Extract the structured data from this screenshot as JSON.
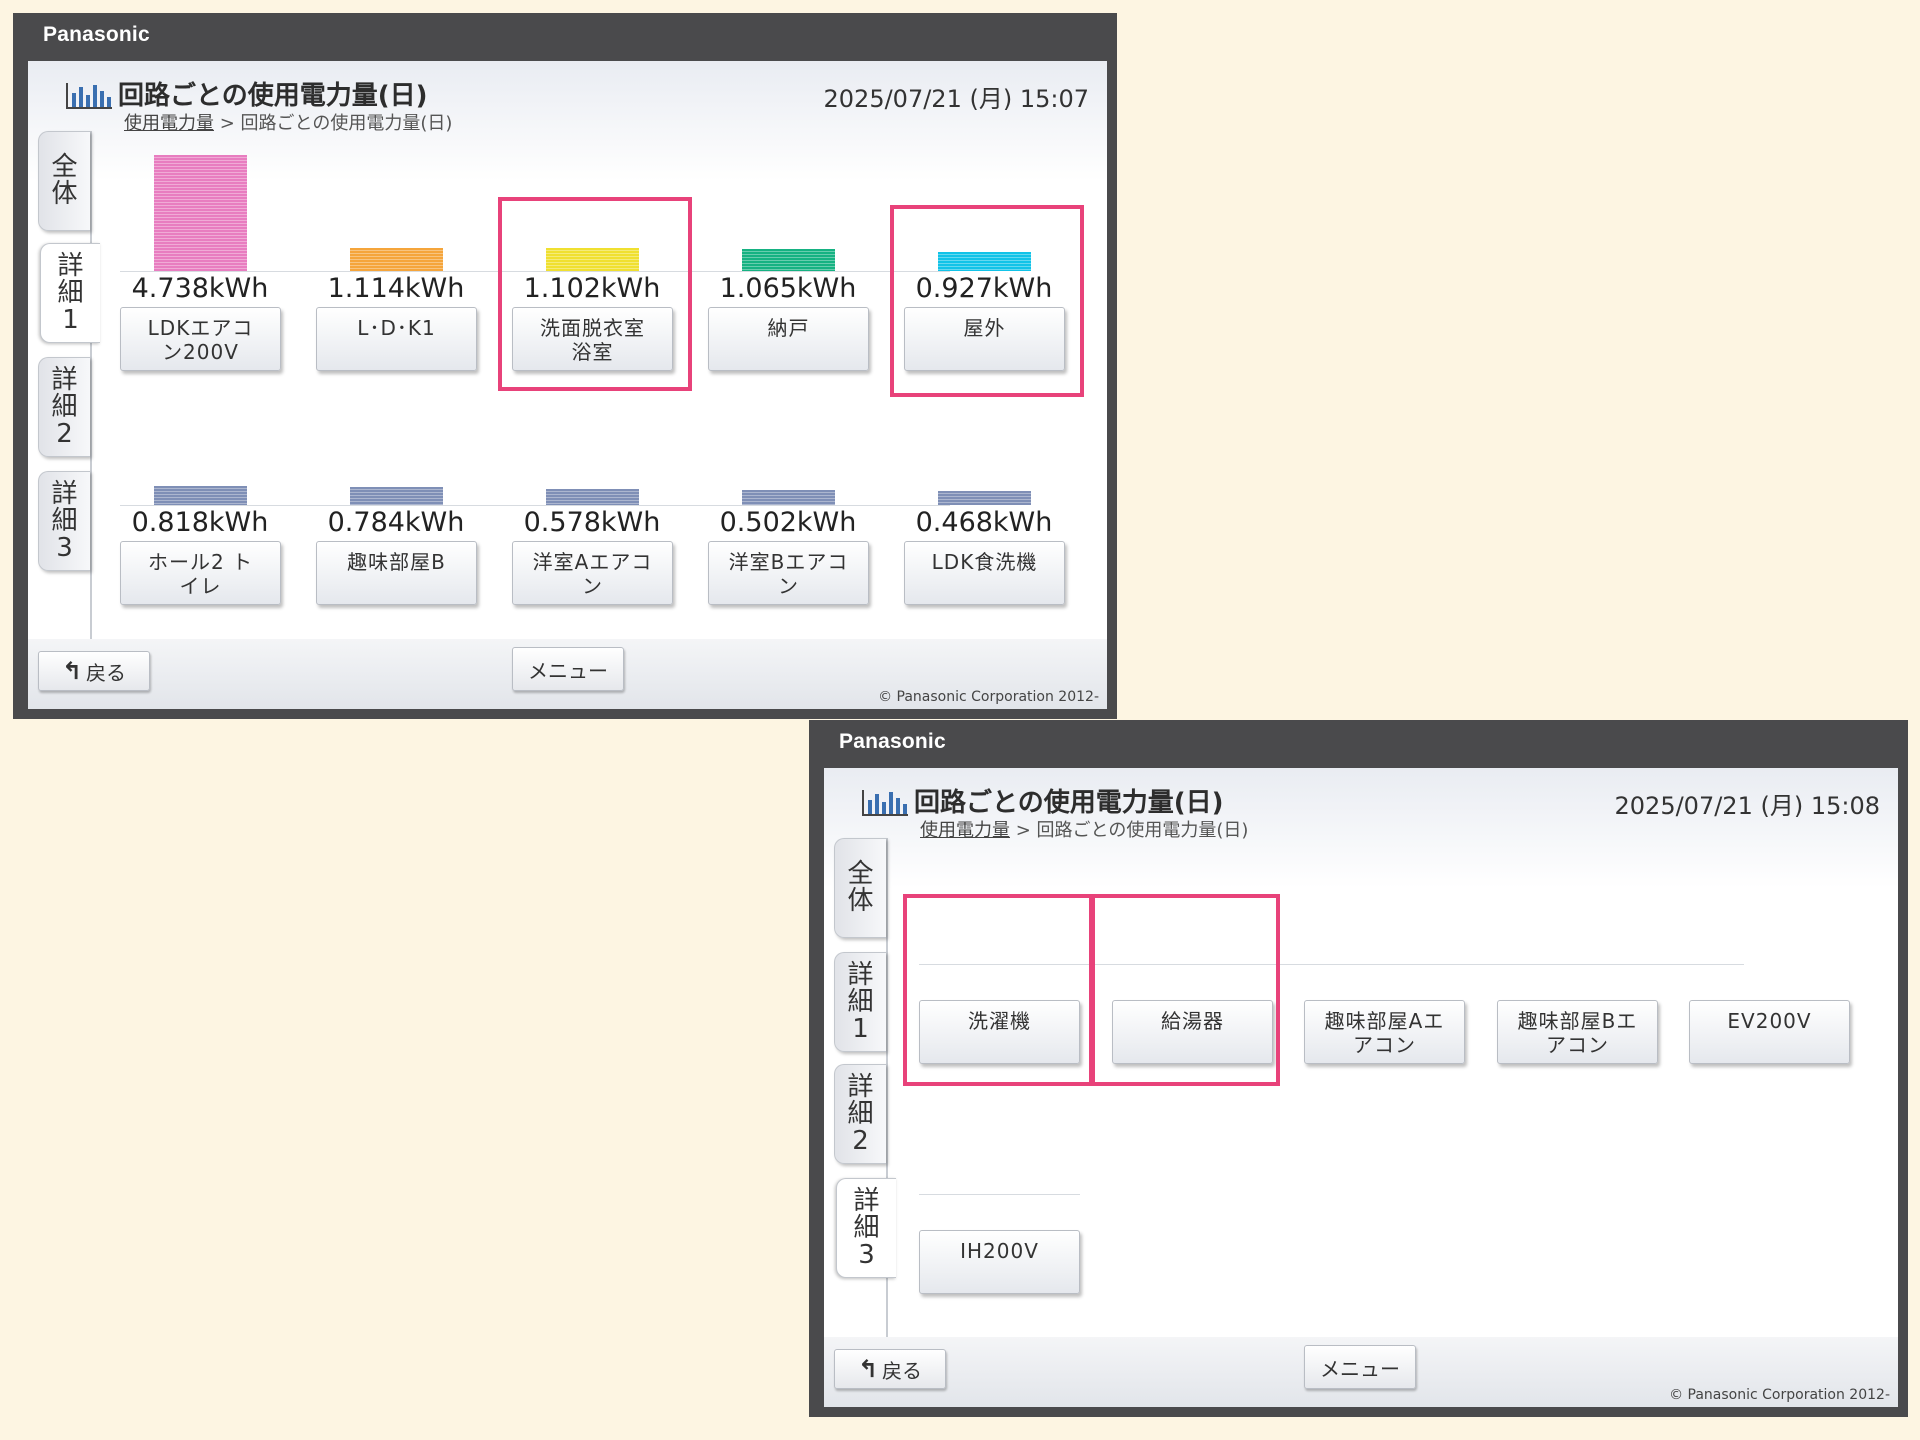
{
  "colors": {
    "highlight": "#e8427a",
    "frame": "#4a4a4c",
    "background": "#fdf5e2"
  },
  "screen1": {
    "brand": "Panasonic",
    "title": "回路ごとの使用電力量(日)",
    "breadcrumb": {
      "link": "使用電力量",
      "current": " > 回路ごとの使用電力量(日)"
    },
    "datetime": "2025/07/21 (月) 15:07",
    "tabs": [
      "全\n体",
      "詳\n細\n1",
      "詳\n細\n2",
      "詳\n細\n3"
    ],
    "active_tab": 1,
    "circuits": [
      {
        "label": "LDKエアコ\nン200V",
        "value": "4.738kWh",
        "kwh": 4.738,
        "color": "#e87dc0",
        "highlighted": false
      },
      {
        "label": "L･D･K1",
        "value": "1.114kWh",
        "kwh": 1.114,
        "color": "#f5a53b",
        "highlighted": false
      },
      {
        "label": "洗面脱衣室\n浴室",
        "value": "1.102kWh",
        "kwh": 1.102,
        "color": "#f0e030",
        "highlighted": true
      },
      {
        "label": "納戸",
        "value": "1.065kWh",
        "kwh": 1.065,
        "color": "#16b282",
        "highlighted": false
      },
      {
        "label": "屋外",
        "value": "0.927kWh",
        "kwh": 0.927,
        "color": "#12c3e8",
        "highlighted": true
      },
      {
        "label": "ホール2 ト\nイレ",
        "value": "0.818kWh",
        "kwh": 0.818,
        "color": "#7f8fb6",
        "highlighted": false
      },
      {
        "label": "趣味部屋B",
        "value": "0.784kWh",
        "kwh": 0.784,
        "color": "#7f8fb6",
        "highlighted": false
      },
      {
        "label": "洋室Aエアコ\nン",
        "value": "0.578kWh",
        "kwh": 0.578,
        "color": "#7f8fb6",
        "highlighted": false
      },
      {
        "label": "洋室Bエアコ\nン",
        "value": "0.502kWh",
        "kwh": 0.502,
        "color": "#7f8fb6",
        "highlighted": false
      },
      {
        "label": "LDK食洗機",
        "value": "0.468kWh",
        "kwh": 0.468,
        "color": "#7f8fb6",
        "highlighted": false
      }
    ],
    "back_label": "戻る",
    "menu_label": "メニュー",
    "copyright": "© Panasonic Corporation 2012-"
  },
  "screen2": {
    "brand": "Panasonic",
    "title": "回路ごとの使用電力量(日)",
    "breadcrumb": {
      "link": "使用電力量",
      "current": " > 回路ごとの使用電力量(日)"
    },
    "datetime": "2025/07/21 (月) 15:08",
    "tabs": [
      "全\n体",
      "詳\n細\n1",
      "詳\n細\n2",
      "詳\n細\n3"
    ],
    "active_tab": 3,
    "circuits": [
      {
        "label": "洗濯機",
        "highlighted": true
      },
      {
        "label": "給湯器",
        "highlighted": true
      },
      {
        "label": "趣味部屋Aエ\nアコン",
        "highlighted": false
      },
      {
        "label": "趣味部屋Bエ\nアコン",
        "highlighted": false
      },
      {
        "label": "EV200V",
        "highlighted": false
      },
      {
        "label": "IH200V",
        "highlighted": false
      }
    ],
    "back_label": "戻る",
    "menu_label": "メニュー",
    "copyright": "© Panasonic Corporation 2012-"
  }
}
